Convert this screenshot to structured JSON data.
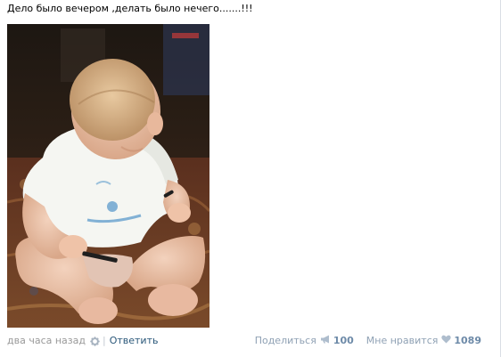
{
  "post": {
    "text": "Дело было вечером ,делать было нечего.......!!!"
  },
  "footer": {
    "time": "два часа назад",
    "separator": "|",
    "reply_label": "Ответить",
    "share_label": "Поделиться",
    "share_count": "100",
    "like_label": "Мне нравится",
    "like_count": "1089"
  },
  "icons": {
    "settings": "gear-icon",
    "share": "megaphone-icon",
    "like": "heart-icon"
  },
  "colors": {
    "link": "#2b587a",
    "muted": "#999999",
    "action_label": "#8fa1b4",
    "count": "#6d8aa8"
  }
}
